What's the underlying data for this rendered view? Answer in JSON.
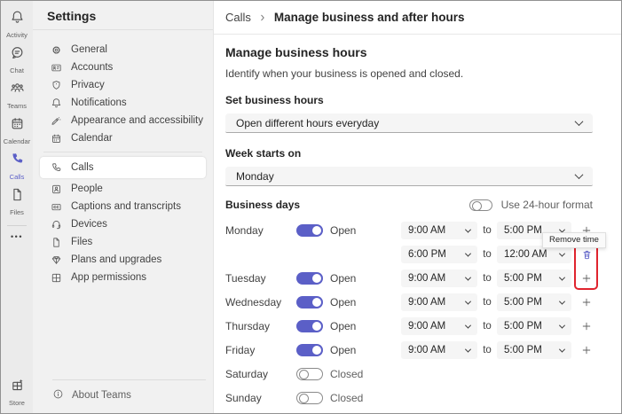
{
  "colors": {
    "accent": "#5B5FC7",
    "highlight": "#e0242e"
  },
  "rail": {
    "items": [
      {
        "label": "Activity",
        "icon": "bell-icon",
        "active": false
      },
      {
        "label": "Chat",
        "icon": "chat-icon",
        "active": false
      },
      {
        "label": "Teams",
        "icon": "teams-people-icon",
        "active": false
      },
      {
        "label": "Calendar",
        "icon": "calendar-icon",
        "active": false
      },
      {
        "label": "Calls",
        "icon": "phone-filled-icon",
        "active": true
      },
      {
        "label": "Files",
        "icon": "document-icon",
        "active": false
      }
    ],
    "store": {
      "label": "Store",
      "icon": "store-icon"
    }
  },
  "sidebar": {
    "title": "Settings",
    "items": [
      {
        "label": "General",
        "icon": "gear-icon",
        "selected": false,
        "group": 1
      },
      {
        "label": "Accounts",
        "icon": "id-card-icon",
        "selected": false,
        "group": 1
      },
      {
        "label": "Privacy",
        "icon": "shield-icon",
        "selected": false,
        "group": 1
      },
      {
        "label": "Notifications",
        "icon": "bell-icon",
        "selected": false,
        "group": 1
      },
      {
        "label": "Appearance and accessibility",
        "icon": "pen-sparkle-icon",
        "selected": false,
        "group": 1
      },
      {
        "label": "Calendar",
        "icon": "calendar-icon",
        "selected": false,
        "group": 1
      },
      {
        "label": "Calls",
        "icon": "phone-icon",
        "selected": true,
        "group": 2
      },
      {
        "label": "People",
        "icon": "person-card-icon",
        "selected": false,
        "group": 2
      },
      {
        "label": "Captions and transcripts",
        "icon": "captions-icon",
        "selected": false,
        "group": 2
      },
      {
        "label": "Devices",
        "icon": "headset-icon",
        "selected": false,
        "group": 2
      },
      {
        "label": "Files",
        "icon": "document-icon",
        "selected": false,
        "group": 2
      },
      {
        "label": "Plans and upgrades",
        "icon": "gem-icon",
        "selected": false,
        "group": 2
      },
      {
        "label": "App permissions",
        "icon": "app-grid-icon",
        "selected": false,
        "group": 2
      }
    ],
    "about_label": "About Teams"
  },
  "header": {
    "breadcrumb_parent": "Calls",
    "breadcrumb_current": "Manage business and after hours"
  },
  "main": {
    "title": "Manage business hours",
    "description": "Identify when your business is opened and closed.",
    "set_hours_label": "Set business hours",
    "set_hours_value": "Open different hours everyday",
    "week_starts_label": "Week starts on",
    "week_starts_value": "Monday",
    "business_days_label": "Business days",
    "format_toggle_label": "Use 24-hour format",
    "format_toggle_on": false,
    "to_label": "to",
    "tooltip_text": "Remove time",
    "rows": [
      {
        "day": "Monday",
        "open": true,
        "state": "Open",
        "from": "9:00 AM",
        "to": "5:00 PM",
        "action": "add"
      },
      {
        "day": "",
        "open": null,
        "state": "",
        "from": "6:00 PM",
        "to": "12:00 AM",
        "action": "remove"
      },
      {
        "day": "Tuesday",
        "open": true,
        "state": "Open",
        "from": "9:00 AM",
        "to": "5:00 PM",
        "action": "add"
      },
      {
        "day": "Wednesday",
        "open": true,
        "state": "Open",
        "from": "9:00 AM",
        "to": "5:00 PM",
        "action": "add"
      },
      {
        "day": "Thursday",
        "open": true,
        "state": "Open",
        "from": "9:00 AM",
        "to": "5:00 PM",
        "action": "add"
      },
      {
        "day": "Friday",
        "open": true,
        "state": "Open",
        "from": "9:00 AM",
        "to": "5:00 PM",
        "action": "add"
      },
      {
        "day": "Saturday",
        "open": false,
        "state": "Closed",
        "from": "",
        "to": "",
        "action": ""
      },
      {
        "day": "Sunday",
        "open": false,
        "state": "Closed",
        "from": "",
        "to": "",
        "action": ""
      }
    ]
  }
}
